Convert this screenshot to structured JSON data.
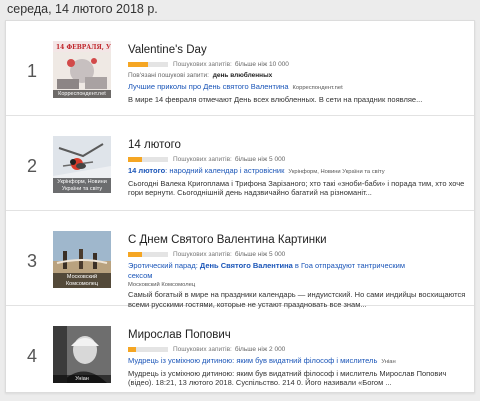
{
  "header": {
    "date": "середа, 14 лютого 2018 р."
  },
  "colors": {
    "accent": "#f5a623",
    "link": "#1a55b8"
  },
  "trends": [
    {
      "rank": "1",
      "thumb_source": "Корреспондент.net",
      "title": "Valentine's Day",
      "volume_label": "Пошукових запитів:",
      "volume_value": "більше ніж 10 000",
      "volume_level": 0.5,
      "related_label": "Пов'язані пошукові запити:",
      "related_value": "день влюбленных",
      "article_title": "Лучшие приколы про День святого Валентина",
      "article_title_bold": "",
      "article_title_rest": "",
      "article_source": "Корреспондент.net",
      "article_snippet": "В мире 14 февраля отмечают День всех влюбленных. В сети на праздник появляе..."
    },
    {
      "rank": "2",
      "thumb_source": "Укрінформ, Новини України та світу",
      "title": "14 лютого",
      "volume_label": "Пошукових запитів:",
      "volume_value": "більше ніж 5 000",
      "volume_level": 0.35,
      "related_label": "",
      "related_value": "",
      "article_title": "",
      "article_title_bold": "14 лютого",
      "article_title_rest": ": народний календар і астровісник",
      "article_source": "Укрінформ, Новини України та світу",
      "article_snippet": "Сьогодні Валека Кригоплама і Трифона Зарізаного; хто такі «зноби-баби» і порада тим, хто хоче гори вернути. Сьогоднішній день надзвичайно багатий на різноманіт..."
    },
    {
      "rank": "3",
      "thumb_source": "Московский Комсомолец",
      "title": "С Днем Святого Валентина Картинки",
      "volume_label": "Пошукових запитів:",
      "volume_value": "більше ніж 5 000",
      "volume_level": 0.35,
      "related_label": "",
      "related_value": "",
      "article_title": "Эротический парад: ",
      "article_title_bold": "День Святого Валентина",
      "article_title_rest": " в Гоа отпраздуют тантрическим сексом",
      "article_source": "Московский Комсомолец",
      "article_snippet": "Самый богатый в мире на праздники календарь — индуистский. Но сами индийцы восхищаются всеми русскими гостями, которые не устают праздновать все знам..."
    },
    {
      "rank": "4",
      "thumb_source": "Уніан",
      "title": "Мирослав Попович",
      "volume_label": "Пошукових запитів:",
      "volume_value": "більше ніж 2 000",
      "volume_level": 0.2,
      "related_label": "",
      "related_value": "",
      "article_title": "Мудрець із усміхною дитиною: яким був видатний філософ і мислитель",
      "article_title_bold": "",
      "article_title_rest": "",
      "article_source": "Уніан",
      "article_snippet": "Мудрець із усміхною дитиною: яким був видатний філософ і мислитель Мирослав Попович (відео). 18:21, 13 лютого 2018. Суспільство. 214 0. Його називали «Богом ..."
    }
  ]
}
